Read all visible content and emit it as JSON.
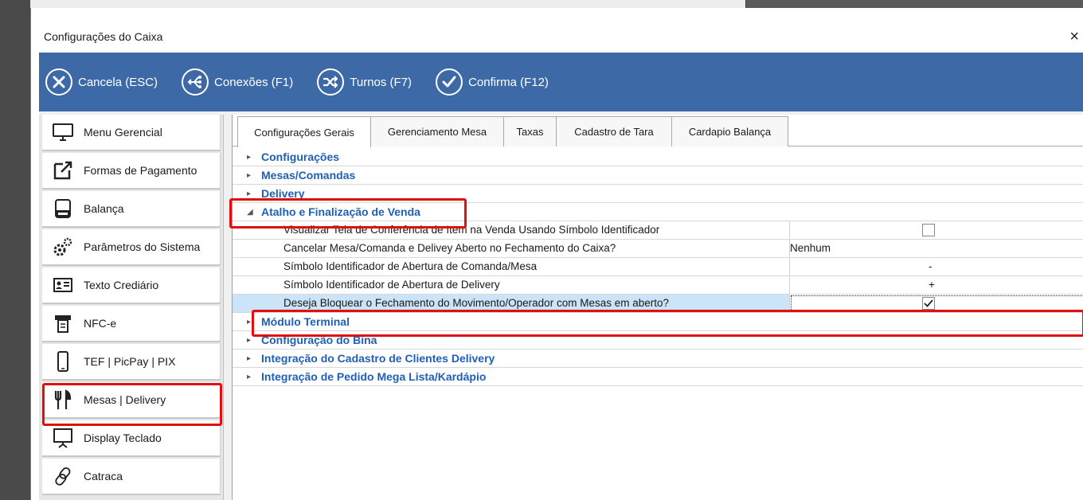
{
  "window": {
    "title": "Configurações do Caixa",
    "close_glyph": "×"
  },
  "toolbar": {
    "buttons": [
      {
        "label": "Cancela (ESC)",
        "icon": "close-icon"
      },
      {
        "label": "Conexões (F1)",
        "icon": "connections-icon"
      },
      {
        "label": "Turnos (F7)",
        "icon": "shuffle-icon"
      },
      {
        "label": "Confirma (F12)",
        "icon": "checkmark-icon"
      }
    ],
    "color": "#3d6aa6"
  },
  "sidebar": {
    "items": [
      {
        "label": "Menu Gerencial",
        "icon": "monitor-icon"
      },
      {
        "label": "Formas de Pagamento",
        "icon": "external-link-icon"
      },
      {
        "label": "Balança",
        "icon": "scale-icon"
      },
      {
        "label": "Parâmetros do Sistema",
        "icon": "gears-icon"
      },
      {
        "label": "Texto Crediário",
        "icon": "id-card-icon"
      },
      {
        "label": "NFC-e",
        "icon": "receipt-icon"
      },
      {
        "label": "TEF | PicPay | PIX",
        "icon": "smartphone-icon"
      },
      {
        "label": "Mesas | Delivery",
        "icon": "cutlery-icon"
      },
      {
        "label": "Display Teclado",
        "icon": "display-icon"
      },
      {
        "label": "Catraca",
        "icon": "link-icon"
      }
    ]
  },
  "tabs": [
    {
      "label": "Configurações Gerais",
      "active": true
    },
    {
      "label": "Gerenciamento Mesa",
      "active": false
    },
    {
      "label": "Taxas",
      "active": false
    },
    {
      "label": "Cadastro de Tara",
      "active": false
    },
    {
      "label": "Cardapio Balança",
      "active": false
    }
  ],
  "grid": {
    "groups_before": [
      {
        "label": "Configurações",
        "expanded": false
      },
      {
        "label": "Mesas/Comandas",
        "expanded": false
      },
      {
        "label": "Delivery",
        "expanded": false
      }
    ],
    "expanded_group": {
      "label": "Atalho e Finalização de Venda",
      "expanded": true
    },
    "properties": [
      {
        "name": "Visualizar Tela de Conferência de Item na Venda Usando Símbolo Identificador",
        "type": "checkbox",
        "checked": false,
        "value": ""
      },
      {
        "name": "Cancelar Mesa/Comanda e Delivey Aberto no Fechamento do Caixa?",
        "type": "text",
        "value": "Nenhum"
      },
      {
        "name": "Símbolo Identificador de Abertura de Comanda/Mesa",
        "type": "text-center",
        "value": "-"
      },
      {
        "name": "Símbolo Identificador de Abertura de Delivery",
        "type": "text-center",
        "value": "+"
      },
      {
        "name": "Deseja Bloquear o Fechamento do Movimento/Operador com Mesas em aberto?",
        "type": "checkbox",
        "checked": true,
        "value": "",
        "selected": true
      }
    ],
    "groups_after": [
      {
        "label": "Módulo Terminal",
        "expanded": false
      },
      {
        "label": "Configuração do Bina",
        "expanded": false
      },
      {
        "label": "Integração do Cadastro de Clientes Delivery",
        "expanded": false
      },
      {
        "label": "Integração de Pedido Mega Lista/Kardápio",
        "expanded": false
      }
    ],
    "group_color": "#1f5fb5",
    "selection_color": "#cce4f7",
    "highlight_color": "#e01010"
  }
}
